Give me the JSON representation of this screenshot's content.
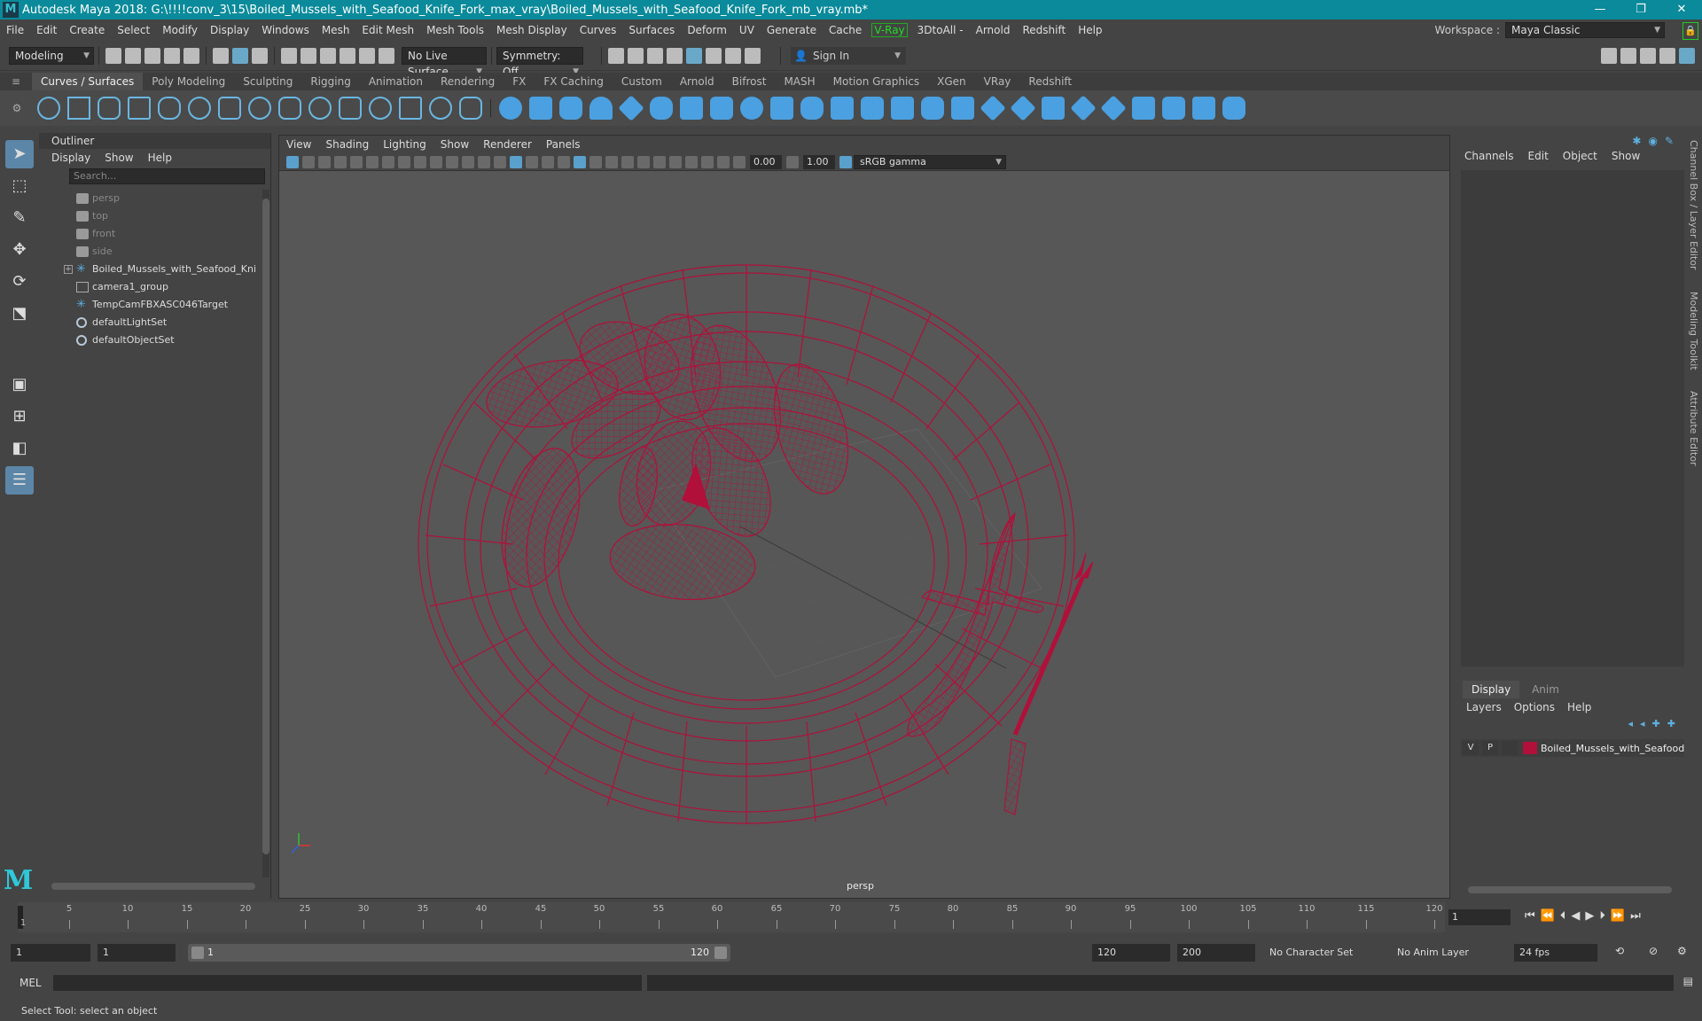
{
  "window": {
    "title": "Autodesk Maya 2018: G:\\!!!!conv_3\\15\\Boiled_Mussels_with_Seafood_Knife_Fork_max_vray\\Boiled_Mussels_with_Seafood_Knife_Fork_mb_vray.mb*",
    "logo_letter": "M",
    "minimize": "—",
    "maximize": "❐",
    "close": "✕"
  },
  "menubar": {
    "items": [
      "File",
      "Edit",
      "Create",
      "Select",
      "Modify",
      "Display",
      "Windows",
      "Mesh",
      "Edit Mesh",
      "Mesh Tools",
      "Mesh Display",
      "Curves",
      "Surfaces",
      "Deform",
      "UV",
      "Generate",
      "Cache"
    ],
    "vray": "V-Ray",
    "items2": [
      "3DtoAll -",
      "Arnold",
      "Redshift",
      "Help"
    ],
    "workspace_label": "Workspace :",
    "workspace_value": "Maya Classic"
  },
  "statusline": {
    "mode": "Modeling",
    "live_surface": "No Live Surface",
    "symmetry": "Symmetry: Off",
    "sign_in": "Sign In"
  },
  "shelf": {
    "tabs": [
      "Curves / Surfaces",
      "Poly Modeling",
      "Sculpting",
      "Rigging",
      "Animation",
      "Rendering",
      "FX",
      "FX Caching",
      "Custom",
      "Arnold",
      "Bifrost",
      "MASH",
      "Motion Graphics",
      "XGen",
      "VRay",
      "Redshift"
    ],
    "active_tab": "Curves / Surfaces"
  },
  "outliner": {
    "title": "Outliner",
    "menu": [
      "Display",
      "Show",
      "Help"
    ],
    "search_placeholder": "Search...",
    "items": [
      {
        "label": "persp",
        "icon": "camera-icon",
        "dim": true
      },
      {
        "label": "top",
        "icon": "camera-icon",
        "dim": true
      },
      {
        "label": "front",
        "icon": "camera-icon",
        "dim": true
      },
      {
        "label": "side",
        "icon": "camera-icon",
        "dim": true
      },
      {
        "label": "Boiled_Mussels_with_Seafood_Knife_",
        "icon": "transform-star-icon",
        "dim": false,
        "expandable": true
      },
      {
        "label": "camera1_group",
        "icon": "group-icon",
        "dim": false
      },
      {
        "label": "TempCamFBXASC046Target",
        "icon": "transform-star-icon",
        "dim": false
      },
      {
        "label": "defaultLightSet",
        "icon": "set-icon",
        "dim": false
      },
      {
        "label": "defaultObjectSet",
        "icon": "set-icon",
        "dim": false
      }
    ]
  },
  "viewport": {
    "menu": [
      "View",
      "Shading",
      "Lighting",
      "Show",
      "Renderer",
      "Panels"
    ],
    "exposure": "0.00",
    "gamma": "1.00",
    "color_space": "sRGB gamma",
    "camera_label": "persp",
    "wire_color": "#b0103a"
  },
  "channelbox": {
    "menu": [
      "Channels",
      "Edit",
      "Object",
      "Show"
    ],
    "side_tabs": [
      "Channel Box / Layer Editor",
      "Modeling Toolkit",
      "Attribute Editor"
    ]
  },
  "layers": {
    "tabs": [
      "Display",
      "Anim"
    ],
    "menu": [
      "Layers",
      "Options",
      "Help"
    ],
    "row": {
      "v": "V",
      "p": "P",
      "name": "Boiled_Mussels_with_Seafood",
      "color": "#b0103a"
    }
  },
  "timeslider": {
    "ticks": [
      "5",
      "10",
      "15",
      "20",
      "25",
      "30",
      "35",
      "40",
      "45",
      "50",
      "55",
      "60",
      "65",
      "70",
      "75",
      "80",
      "85",
      "90",
      "95",
      "100",
      "105",
      "110",
      "115",
      "120"
    ],
    "current_frame_marker": "1",
    "current_frame": "1"
  },
  "rangeslider": {
    "start": "1",
    "anim_start": "1",
    "range_start": "1",
    "range_end": "120",
    "end": "120",
    "anim_end": "200",
    "character_set": "No Character Set",
    "anim_layer": "No Anim Layer",
    "fps": "24 fps"
  },
  "cmdline": {
    "label": "MEL"
  },
  "helpline": {
    "text": "Select Tool: select an object"
  }
}
